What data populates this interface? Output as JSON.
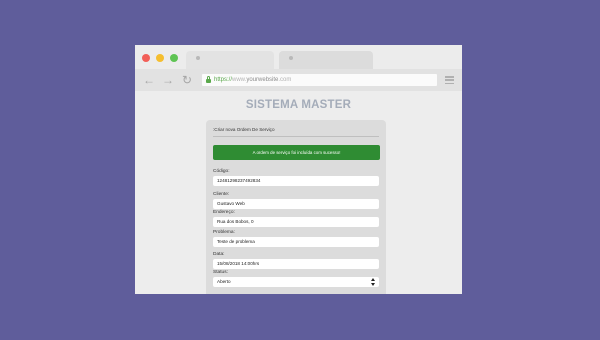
{
  "browser": {
    "window_controls": {
      "close_color": "#f25f58",
      "minimize_color": "#f5be2f",
      "maximize_color": "#5fc454"
    },
    "nav": {
      "back_icon": "←",
      "forward_icon": "→",
      "reload_icon": "↻"
    },
    "address": {
      "protocol": "https://",
      "prefix": "www.",
      "domain": "yourwebsite",
      "suffix": ".com"
    }
  },
  "page": {
    "title": "SISTEMA MASTER",
    "form": {
      "header": ":Criar nova Ordem De Serviço",
      "alert": "A ordem de serviço foi incluída com sucesso!",
      "fields": [
        {
          "label": "Código:",
          "value": "12481298237492834"
        },
        {
          "label": "Cliente:",
          "value": "Gustavo Web"
        },
        {
          "label": "Endereço:",
          "value": "Rua dos Bobos, 0"
        },
        {
          "label": "Problema:",
          "value": "Teste de problema"
        },
        {
          "label": "Data:",
          "value": "15/08/2018 14:00hrs"
        },
        {
          "label": "Status:",
          "value": "Aberto"
        }
      ]
    }
  },
  "colors": {
    "background": "#5f5d9b",
    "alert_green": "#2f8c33",
    "title_gray": "#a4acb9"
  }
}
